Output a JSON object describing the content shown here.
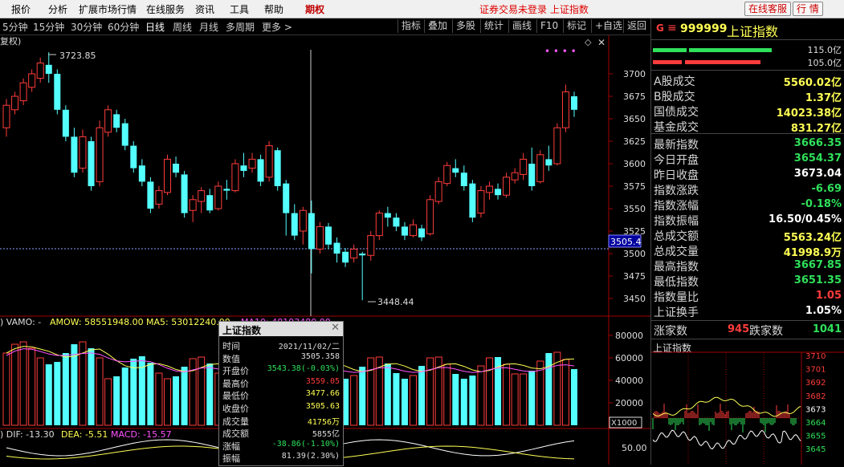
{
  "menu": {
    "items": [
      "报价",
      "分析",
      "扩展市场行情",
      "在线服务",
      "资讯",
      "工具",
      "帮助",
      "期权"
    ],
    "status_message": "证券交易未登录 上证指数",
    "btn_service": "在线客服",
    "btn_quote": "行 情"
  },
  "toolbar": {
    "periods": [
      "5分钟",
      "15分钟",
      "30分钟",
      "60分钟",
      "日线",
      "周线",
      "月线",
      "多周期",
      "更多 >"
    ],
    "selected_period": "日线",
    "buttons": [
      "指标",
      "叠加",
      "多股",
      "统计",
      "画线",
      "F10",
      "标记",
      "+自选",
      "返回"
    ]
  },
  "chart": {
    "title_fragment": "复权)",
    "price_axis": [
      "3700",
      "3675",
      "3650",
      "3625",
      "3600",
      "3575",
      "3550",
      "3525",
      "3500",
      "3475",
      "3450"
    ],
    "current_price_label": "3505.4",
    "high_annotation": "3723.85",
    "low_annotation": "3448.44",
    "volume_legend": {
      "prefix": ") VAMO: -",
      "amow": "AMOW: 58551948.00",
      "ma5": "MA5: 53012240.00",
      "ma10": "MA10: 48193480.00"
    },
    "volume_axis": [
      "80000",
      "60000",
      "40000",
      "20000"
    ],
    "volume_unit": "X1000",
    "macd_legend": {
      "prefix": ") DIF: -13.30",
      "dea": "DEA: -5.51",
      "macd": "MACD: -15.57"
    },
    "macd_axis": "50.00"
  },
  "colors": {
    "up": "#ff3c3c",
    "down": "#54ffff",
    "ma_yellow": "#ffff54",
    "ma_magenta": "#ff54ff",
    "value_yellow": "#ffff54",
    "value_green": "#2fe05a",
    "value_red": "#ff3c3c",
    "axis_red": "#a00000"
  },
  "tooltip": {
    "title": "上证指数",
    "rows": [
      {
        "label": "时间",
        "value": "2021/11/02/二",
        "color": "#dddddd"
      },
      {
        "label": "数值",
        "value": "3505.358",
        "color": "#dddddd"
      },
      {
        "label": "开盘价",
        "value": "3543.38(-0.03%)",
        "color": "#2fe05a"
      },
      {
        "label": "最高价",
        "value": "3559.05",
        "color": "#ff3c3c"
      },
      {
        "label": "最低价",
        "value": "3477.66",
        "color": "#ffff54"
      },
      {
        "label": "收盘价",
        "value": "3505.63",
        "color": "#ffff54"
      },
      {
        "label": "成交量",
        "value": "41756万",
        "color": "#ffff54"
      },
      {
        "label": "成交额",
        "value": "5855亿",
        "color": "#dddddd"
      },
      {
        "label": "涨幅",
        "value": "-38.86(-1.10%)",
        "color": "#2fe05a"
      },
      {
        "label": "振幅",
        "value": "81.39(2.30%)",
        "color": "#dddddd"
      }
    ]
  },
  "right_panel": {
    "code": "999999",
    "name": "上证指数",
    "bar_top_label": "115.0亿",
    "bar_bottom_label": "105.0亿",
    "turnover": [
      {
        "label": "A股成交",
        "value": "5560.02亿",
        "color": "#ffff54"
      },
      {
        "label": "B股成交",
        "value": "1.37亿",
        "color": "#ffff54"
      },
      {
        "label": "国债成交",
        "value": "14023.38亿",
        "color": "#ffff54"
      },
      {
        "label": "基金成交",
        "value": "831.27亿",
        "color": "#ffff54"
      }
    ],
    "stats": [
      {
        "label": "最新指数",
        "value": "3666.35",
        "color": "#2fe05a"
      },
      {
        "label": "今日开盘",
        "value": "3654.37",
        "color": "#2fe05a"
      },
      {
        "label": "昨日收盘",
        "value": "3673.04",
        "color": "#ffffff"
      },
      {
        "label": "指数涨跌",
        "value": "-6.69",
        "color": "#2fe05a"
      },
      {
        "label": "指数涨幅",
        "value": "-0.18%",
        "color": "#2fe05a"
      },
      {
        "label": "指数振幅",
        "value": "16.50/0.45%",
        "color": "#ffffff"
      },
      {
        "label": "总成交额",
        "value": "5563.24亿",
        "color": "#ffff54"
      },
      {
        "label": "总成交量",
        "value": "41998.9万",
        "color": "#ffff54"
      },
      {
        "label": "最高指数",
        "value": "3667.85",
        "color": "#2fe05a"
      },
      {
        "label": "最低指数",
        "value": "3651.35",
        "color": "#2fe05a"
      },
      {
        "label": "指数量比",
        "value": "1.05",
        "color": "#ff3c3c"
      },
      {
        "label": "上证换手",
        "value": "1.05%",
        "color": "#ffffff"
      }
    ],
    "adv_label": "涨家数",
    "adv_value": "945",
    "dec_label": "跌家数",
    "dec_value": "1041",
    "mini_title": "上证指数",
    "mini_axis": [
      "3710",
      "3701",
      "3692",
      "3682",
      "3673",
      "3664",
      "3655",
      "3645"
    ]
  }
}
